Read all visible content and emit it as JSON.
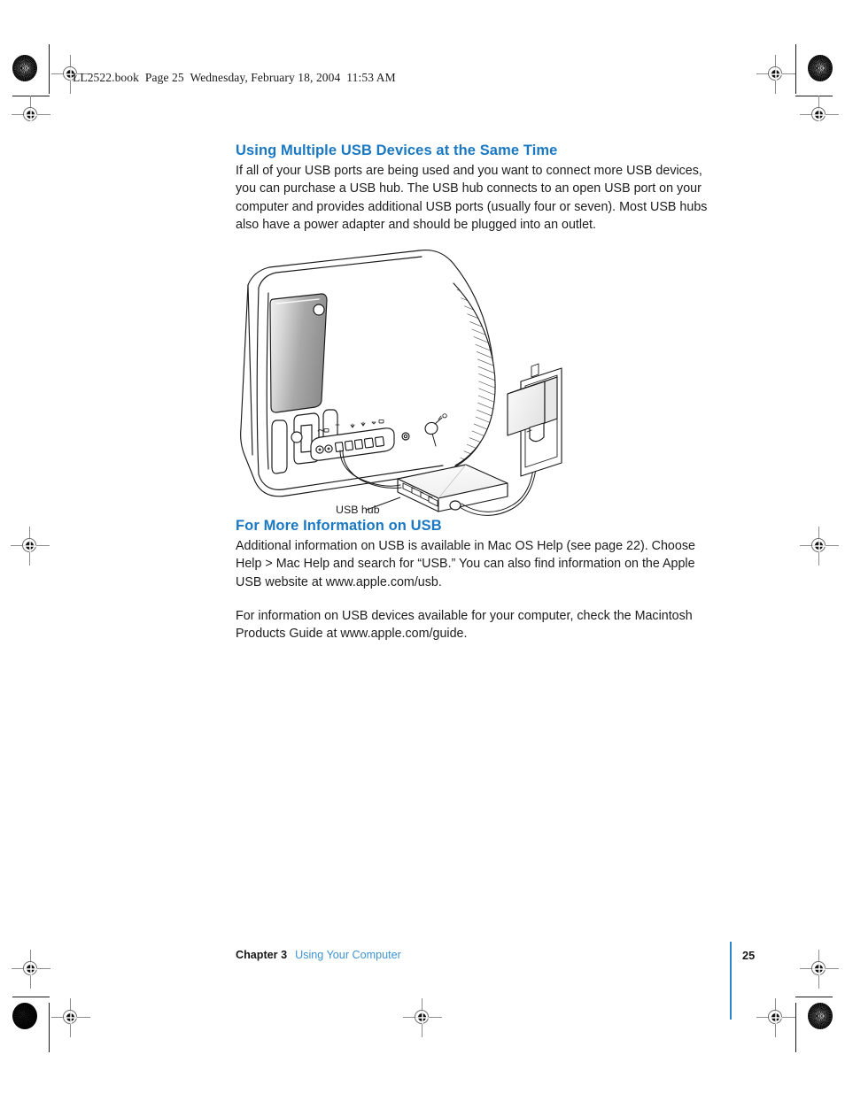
{
  "page": {
    "header_line": "LL2522.book  Page 25  Wednesday, February 18, 2004  11:53 AM",
    "background": "#ffffff",
    "heading_color": "#1a78c3",
    "link_color": "#3e93d0",
    "rule_color": "#2f86c9"
  },
  "sections": [
    {
      "heading": "Using Multiple USB Devices at the Same Time",
      "paragraphs": [
        "If all of your USB ports are being used and you want to connect more USB devices, you can purchase a USB hub. The USB hub connects to an open USB port on your computer and provides additional USB ports (usually four or seven). Most USB hubs also have a power adapter and should be plugged into an outlet."
      ]
    },
    {
      "heading": "For More Information on USB",
      "paragraphs": [
        "Additional information on USB is available in Mac OS Help (see page 22). Choose Help > Mac Help and search for “USB.” You can also find information on the Apple USB website at www.apple.com/usb.",
        "For information on USB devices available for your computer, check the Macintosh Products Guide at www.apple.com/guide."
      ]
    }
  ],
  "figure": {
    "caption": "USB hub",
    "alt": "Line drawing of an iMac computer with a USB hub connected to one of its USB ports and the hub's power adapter plugged into a wall outlet"
  },
  "footer": {
    "chapter": "Chapter 3",
    "chapter_title": "Using Your Computer",
    "page_number": "25"
  }
}
